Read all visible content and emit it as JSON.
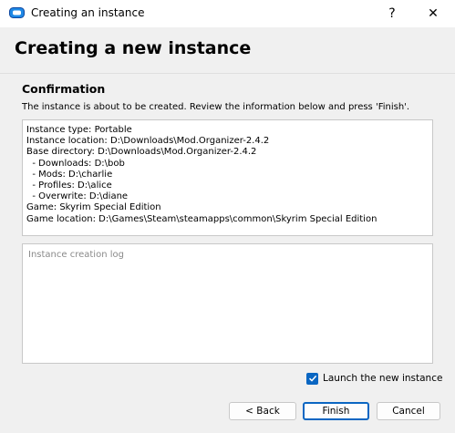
{
  "window": {
    "title": "Creating an instance",
    "help_label": "?",
    "close_label": "✕",
    "app_icon": "mod-organizer-icon"
  },
  "header": {
    "title": "Creating a new instance"
  },
  "confirmation": {
    "heading": "Confirmation",
    "description": "The instance is about to be created. Review the information below and press 'Finish'.",
    "summary_lines": [
      "Instance type: Portable",
      "Instance location: D:\\Downloads\\Mod.Organizer-2.4.2",
      "Base directory: D:\\Downloads\\Mod.Organizer-2.4.2",
      "  - Downloads: D:\\bob",
      "  - Mods: D:\\charlie",
      "  - Profiles: D:\\alice",
      "  - Overwrite: D:\\diane",
      "Game: Skyrim Special Edition",
      "Game location: D:\\Games\\Steam\\steamapps\\common\\Skyrim Special Edition"
    ],
    "log_placeholder": "Instance creation log"
  },
  "launch": {
    "label": "Launch the new instance",
    "checked": true
  },
  "buttons": {
    "back": "< Back",
    "finish": "Finish",
    "cancel": "Cancel"
  },
  "colors": {
    "accent": "#0a66c2",
    "background": "#f0f0f0"
  }
}
